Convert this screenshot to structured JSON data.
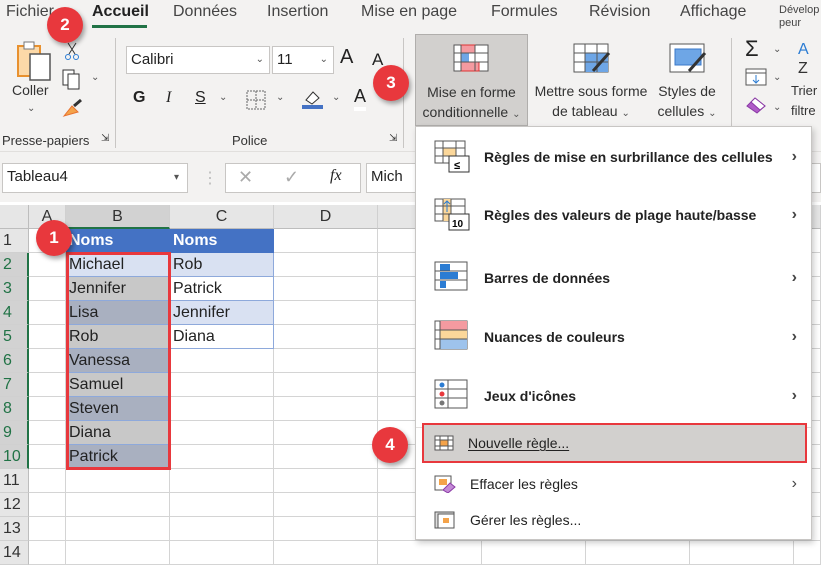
{
  "tabs": [
    {
      "label": "Fichier"
    },
    {
      "label": "Accueil",
      "active": true
    },
    {
      "label": "Données"
    },
    {
      "label": "Insertion"
    },
    {
      "label": "Mise en page"
    },
    {
      "label": "Formules"
    },
    {
      "label": "Révision"
    },
    {
      "label": "Affichage"
    },
    {
      "label": "Développeur"
    }
  ],
  "clipboard": {
    "paste": "Coller",
    "group": "Presse-papiers"
  },
  "font": {
    "name": "Calibri",
    "size": "11",
    "bold": "G",
    "italic": "I",
    "underline": "S",
    "grow": "A",
    "shrink": "A",
    "color": "A",
    "group": "Police"
  },
  "styles": {
    "conditional_line1": "Mise en forme",
    "conditional_line2": "conditionnelle",
    "table_line1": "Mettre sous forme",
    "table_line2": "de tableau",
    "cell_line1": "Styles de",
    "cell_line2": "cellules"
  },
  "editing": {
    "sum": "Σ",
    "sort_line1": "Trier",
    "sort_line2": "filtre"
  },
  "formula_bar": {
    "name_box": "Tableau4",
    "fx": "fx",
    "value": "Mich"
  },
  "columns": [
    "A",
    "B",
    "C",
    "D"
  ],
  "rows": [
    "1",
    "2",
    "3",
    "4",
    "5",
    "6",
    "7",
    "8",
    "9",
    "10",
    "11",
    "12",
    "13",
    "14"
  ],
  "col_b": [
    "Noms",
    "Michael",
    "Jennifer",
    "Lisa",
    "Rob",
    "Vanessa",
    "Samuel",
    "Steven",
    "Diana",
    "Patrick"
  ],
  "col_c": [
    "Noms",
    "Rob",
    "Patrick",
    "Jennifer",
    "Diana"
  ],
  "menu": {
    "items": [
      {
        "label": "Règles de mise en surbrillance des cellules",
        "submenu": true,
        "icon": "highlight-rules-icon"
      },
      {
        "label": "Règles des valeurs de plage haute/basse",
        "submenu": true,
        "icon": "top-bottom-rules-icon"
      },
      {
        "label": "Barres de données",
        "submenu": true,
        "icon": "data-bars-icon"
      },
      {
        "label": "Nuances de couleurs",
        "submenu": true,
        "icon": "color-scales-icon"
      },
      {
        "label": "Jeux d'icônes",
        "submenu": true,
        "icon": "icon-sets-icon"
      }
    ],
    "new_rule": "Nouvelle règle...",
    "clear_rules": "Effacer les règles",
    "manage_rules": "Gérer les règles..."
  },
  "badges": [
    "1",
    "2",
    "3",
    "4"
  ],
  "colors": {
    "accent": "#217346",
    "table_header": "#4472c4",
    "band": "#d9e1f2",
    "badge": "#e8383d"
  }
}
